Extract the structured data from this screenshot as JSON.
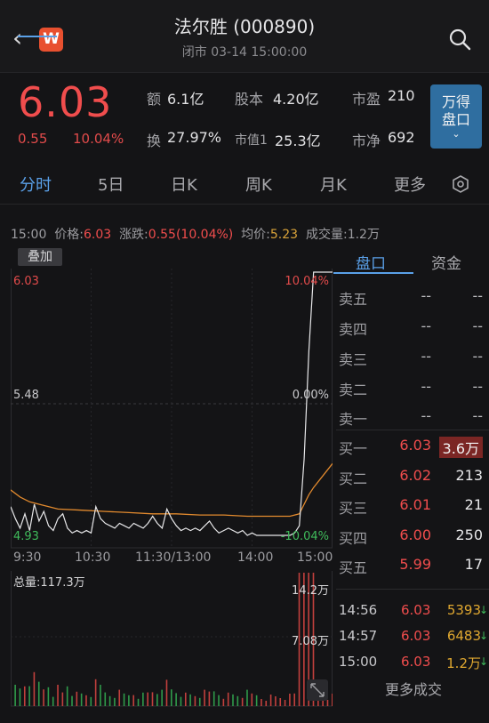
{
  "header": {
    "back_glyph": "‹",
    "logo_letter": "W",
    "title": "法尔胜 (000890)",
    "subtitle": "闭市 03-14 15:00:00",
    "search_icon": "search-icon"
  },
  "quote": {
    "price": "6.03",
    "change": "0.55",
    "change_pct": "10.04%",
    "stats": [
      {
        "label": "额",
        "value": "6.1亿"
      },
      {
        "label": "股本",
        "value": "4.20亿"
      },
      {
        "label": "市盈",
        "value": "210"
      },
      {
        "label": "换",
        "value": "27.97%"
      },
      {
        "label": "市值1",
        "value": "25.3亿"
      },
      {
        "label": "市净",
        "value": "692"
      }
    ],
    "wande_line1": "万得",
    "wande_line2": "盘口",
    "wande_chevron": "⌄"
  },
  "tabs": [
    {
      "label": "分时",
      "active": true
    },
    {
      "label": "5日",
      "active": false
    },
    {
      "label": "日K",
      "active": false
    },
    {
      "label": "周K",
      "active": false
    },
    {
      "label": "月K",
      "active": false
    },
    {
      "label": "更多",
      "active": false
    }
  ],
  "infoline": {
    "time": "15:00",
    "price_label": "价格:",
    "price": "6.03",
    "change_label": "涨跌:",
    "change": "0.55(10.04%)",
    "avg_label": "均价:",
    "avg": "5.23",
    "volume_label": "成交量:",
    "volume": "1.2万"
  },
  "overlay_button": "叠加",
  "chart_data": {
    "type": "line",
    "price_axis_left": [
      "6.03",
      "5.48",
      "4.93"
    ],
    "pct_axis_right": [
      "10.04%",
      "0.00%",
      "-10.04%"
    ],
    "time_ticks": [
      "9:30",
      "10:30",
      "11:30/13:00",
      "14:00",
      "15:00"
    ],
    "ylim": [
      4.93,
      6.03
    ],
    "prev_close": 5.48,
    "price_series": [
      [
        0,
        5.05
      ],
      [
        2,
        5.0
      ],
      [
        4,
        4.96
      ],
      [
        6,
        5.02
      ],
      [
        8,
        4.95
      ],
      [
        10,
        5.06
      ],
      [
        12,
        4.99
      ],
      [
        14,
        5.03
      ],
      [
        16,
        4.97
      ],
      [
        18,
        4.95
      ],
      [
        20,
        5.0
      ],
      [
        22,
        5.02
      ],
      [
        24,
        4.96
      ],
      [
        26,
        4.94
      ],
      [
        28,
        4.95
      ],
      [
        30,
        4.94
      ],
      [
        32,
        4.95
      ],
      [
        34,
        4.94
      ],
      [
        36,
        5.05
      ],
      [
        38,
        5.0
      ],
      [
        40,
        4.98
      ],
      [
        42,
        4.97
      ],
      [
        44,
        4.96
      ],
      [
        46,
        4.98
      ],
      [
        48,
        4.97
      ],
      [
        50,
        4.96
      ],
      [
        52,
        4.98
      ],
      [
        54,
        4.97
      ],
      [
        56,
        4.96
      ],
      [
        58,
        4.98
      ],
      [
        60,
        5.01
      ],
      [
        62,
        4.98
      ],
      [
        64,
        4.96
      ],
      [
        66,
        5.04
      ],
      [
        68,
        5.0
      ],
      [
        70,
        4.97
      ],
      [
        72,
        4.95
      ],
      [
        74,
        4.96
      ],
      [
        76,
        4.95
      ],
      [
        78,
        4.96
      ],
      [
        80,
        4.95
      ],
      [
        82,
        4.97
      ],
      [
        84,
        4.99
      ],
      [
        86,
        4.96
      ],
      [
        88,
        4.94
      ],
      [
        90,
        4.95
      ],
      [
        92,
        4.96
      ],
      [
        94,
        4.95
      ],
      [
        96,
        4.94
      ],
      [
        98,
        4.95
      ],
      [
        100,
        4.93
      ],
      [
        102,
        4.94
      ],
      [
        104,
        4.93
      ],
      [
        106,
        4.93
      ],
      [
        108,
        4.93
      ],
      [
        110,
        4.93
      ],
      [
        112,
        4.93
      ],
      [
        114,
        4.93
      ],
      [
        116,
        4.93
      ],
      [
        118,
        4.93
      ],
      [
        120,
        4.94
      ],
      [
        122,
        4.97
      ],
      [
        124,
        5.25
      ],
      [
        126,
        5.7
      ],
      [
        128,
        6.03
      ],
      [
        130,
        6.03
      ],
      [
        132,
        6.03
      ],
      [
        134,
        6.03
      ],
      [
        136,
        6.03
      ]
    ],
    "avg_series": [
      [
        0,
        5.12
      ],
      [
        4,
        5.09
      ],
      [
        8,
        5.07
      ],
      [
        12,
        5.06
      ],
      [
        20,
        5.04
      ],
      [
        30,
        5.035
      ],
      [
        40,
        5.03
      ],
      [
        50,
        5.025
      ],
      [
        60,
        5.02
      ],
      [
        70,
        5.02
      ],
      [
        80,
        5.015
      ],
      [
        90,
        5.015
      ],
      [
        100,
        5.01
      ],
      [
        110,
        5.01
      ],
      [
        118,
        5.01
      ],
      [
        122,
        5.02
      ],
      [
        124,
        5.06
      ],
      [
        126,
        5.1
      ],
      [
        128,
        5.13
      ],
      [
        132,
        5.18
      ],
      [
        136,
        5.23
      ]
    ],
    "volume_label": "总量:117.3万",
    "volume_ticks": [
      "14.2万",
      "7.08万"
    ]
  },
  "orderbook": {
    "tabs": [
      {
        "label": "盘口",
        "active": true
      },
      {
        "label": "资金",
        "active": false
      }
    ],
    "asks": [
      {
        "label": "卖五",
        "price": "--",
        "vol": "--"
      },
      {
        "label": "卖四",
        "price": "--",
        "vol": "--"
      },
      {
        "label": "卖三",
        "price": "--",
        "vol": "--"
      },
      {
        "label": "卖二",
        "price": "--",
        "vol": "--"
      },
      {
        "label": "卖一",
        "price": "--",
        "vol": "--"
      }
    ],
    "bids": [
      {
        "label": "买一",
        "price": "6.03",
        "vol": "3.6万"
      },
      {
        "label": "买二",
        "price": "6.02",
        "vol": "213"
      },
      {
        "label": "买三",
        "price": "6.01",
        "vol": "21"
      },
      {
        "label": "买四",
        "price": "6.00",
        "vol": "250"
      },
      {
        "label": "买五",
        "price": "5.99",
        "vol": "17"
      }
    ],
    "ticks": [
      {
        "time": "14:56",
        "price": "6.03",
        "vol": "5393",
        "arrow": "↓"
      },
      {
        "time": "14:57",
        "price": "6.03",
        "vol": "6483",
        "arrow": "↓"
      },
      {
        "time": "15:00",
        "price": "6.03",
        "vol": "1.2万",
        "arrow": "↓"
      }
    ],
    "more_trades": "更多成交"
  }
}
